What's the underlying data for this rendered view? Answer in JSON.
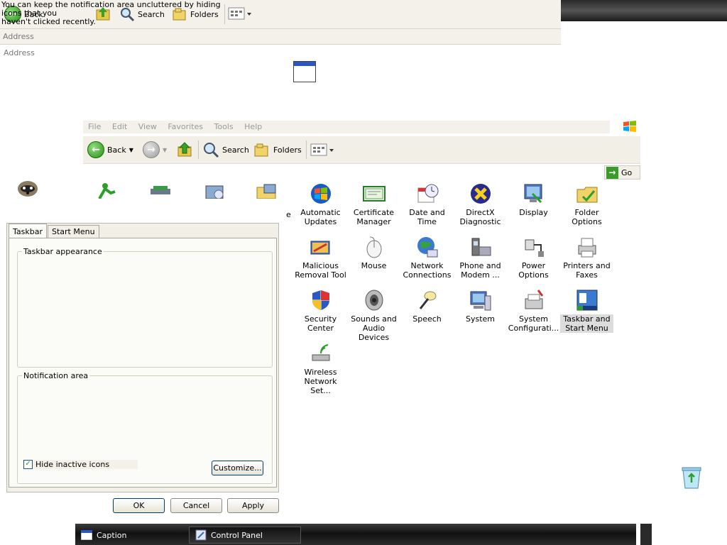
{
  "top_fragment": {
    "tooltip_line1": "You can keep the notification area uncluttered by hiding icons that you",
    "tooltip_line2": "haven't clicked recently.",
    "back_label": "Back",
    "search_label": "Search",
    "folders_label": "Folders",
    "address_label": "Address",
    "address_label_2": "Address"
  },
  "explorer": {
    "menu": [
      "File",
      "Edit",
      "View",
      "Favorites",
      "Tools",
      "Help"
    ],
    "toolbar": {
      "back_label": "Back",
      "search_label": "Search",
      "folders_label": "Folders"
    },
    "go_label": "Go"
  },
  "control_panel": {
    "partial_label": "e",
    "items": [
      {
        "label": "Automatic Updates",
        "icon": "windows-update-icon"
      },
      {
        "label": "Certificate Manager",
        "icon": "certificate-icon"
      },
      {
        "label": "Date and Time",
        "icon": "clock-icon"
      },
      {
        "label": "DirectX Diagnostic",
        "icon": "directx-icon"
      },
      {
        "label": "Display",
        "icon": "display-icon"
      },
      {
        "label": "Folder Options",
        "icon": "folder-icon"
      },
      {
        "label": "Malicious Removal Tool",
        "icon": "malicious-removal-icon"
      },
      {
        "label": "Mouse",
        "icon": "mouse-icon"
      },
      {
        "label": "Network Connections",
        "icon": "network-icon"
      },
      {
        "label": "Phone and Modem ...",
        "icon": "phone-icon"
      },
      {
        "label": "Power Options",
        "icon": "power-icon"
      },
      {
        "label": "Printers and Faxes",
        "icon": "printer-icon"
      },
      {
        "label": "Security Center",
        "icon": "shield-icon"
      },
      {
        "label": "Sounds and Audio Devices",
        "icon": "speaker-icon"
      },
      {
        "label": "Speech",
        "icon": "microphone-icon"
      },
      {
        "label": "System",
        "icon": "computer-icon"
      },
      {
        "label": "System Configurati...",
        "icon": "system-config-icon"
      },
      {
        "label": "Taskbar and Start Menu",
        "icon": "taskbar-icon"
      },
      {
        "label": "Wireless Network Set...",
        "icon": "wireless-icon"
      }
    ]
  },
  "dialog": {
    "tabs": [
      "Taskbar",
      "Start Menu"
    ],
    "group_appearance": "Taskbar appearance",
    "group_notification": "Notification area",
    "hide_inactive_label": "Hide inactive icons",
    "hide_inactive_checked": true,
    "customize_label": "Customize...",
    "ok_label": "OK",
    "cancel_label": "Cancel",
    "apply_label": "Apply"
  },
  "taskbar": {
    "items": [
      "Caption",
      "Control Panel"
    ]
  }
}
